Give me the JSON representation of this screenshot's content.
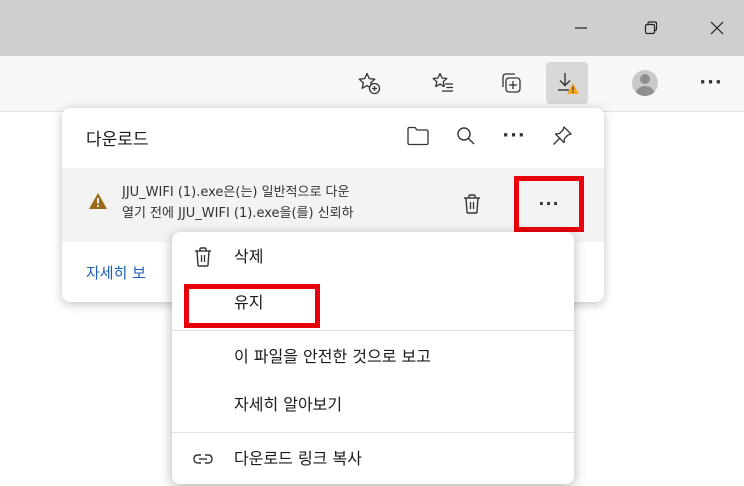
{
  "window": {
    "minimize_icon": "minimize-icon",
    "restore_icon": "restore-icon",
    "close_icon": "close-icon"
  },
  "toolbar": {
    "items": [
      "add-favorite-icon",
      "favorites-icon",
      "collections-icon",
      "downloads-icon",
      "profile-icon",
      "more-icon"
    ],
    "active_item": "downloads-icon",
    "warning_color": "#f5a623"
  },
  "downloads_panel": {
    "title": "다운로드",
    "header_icons": [
      "open-folder-icon",
      "search-icon",
      "more-icon",
      "pin-icon"
    ],
    "item": {
      "line1": "JJU_WIFI (1).exe은(는) 일반적으로 다운",
      "line2": "열기 전에 JJU_WIFI (1).exe을(를) 신뢰하",
      "more_label": "···"
    },
    "see_more": "자세히 보"
  },
  "context_menu": {
    "items": [
      {
        "icon": "trash-icon",
        "label": "삭제"
      },
      {
        "icon": "",
        "label": "유지"
      },
      {
        "icon": "",
        "label": "이 파일을 안전한 것으로 보고"
      },
      {
        "icon": "",
        "label": "자세히 알아보기"
      },
      {
        "icon": "link-icon",
        "label": "다운로드 링크 복사"
      }
    ]
  },
  "highlight_color": "#e8000a"
}
